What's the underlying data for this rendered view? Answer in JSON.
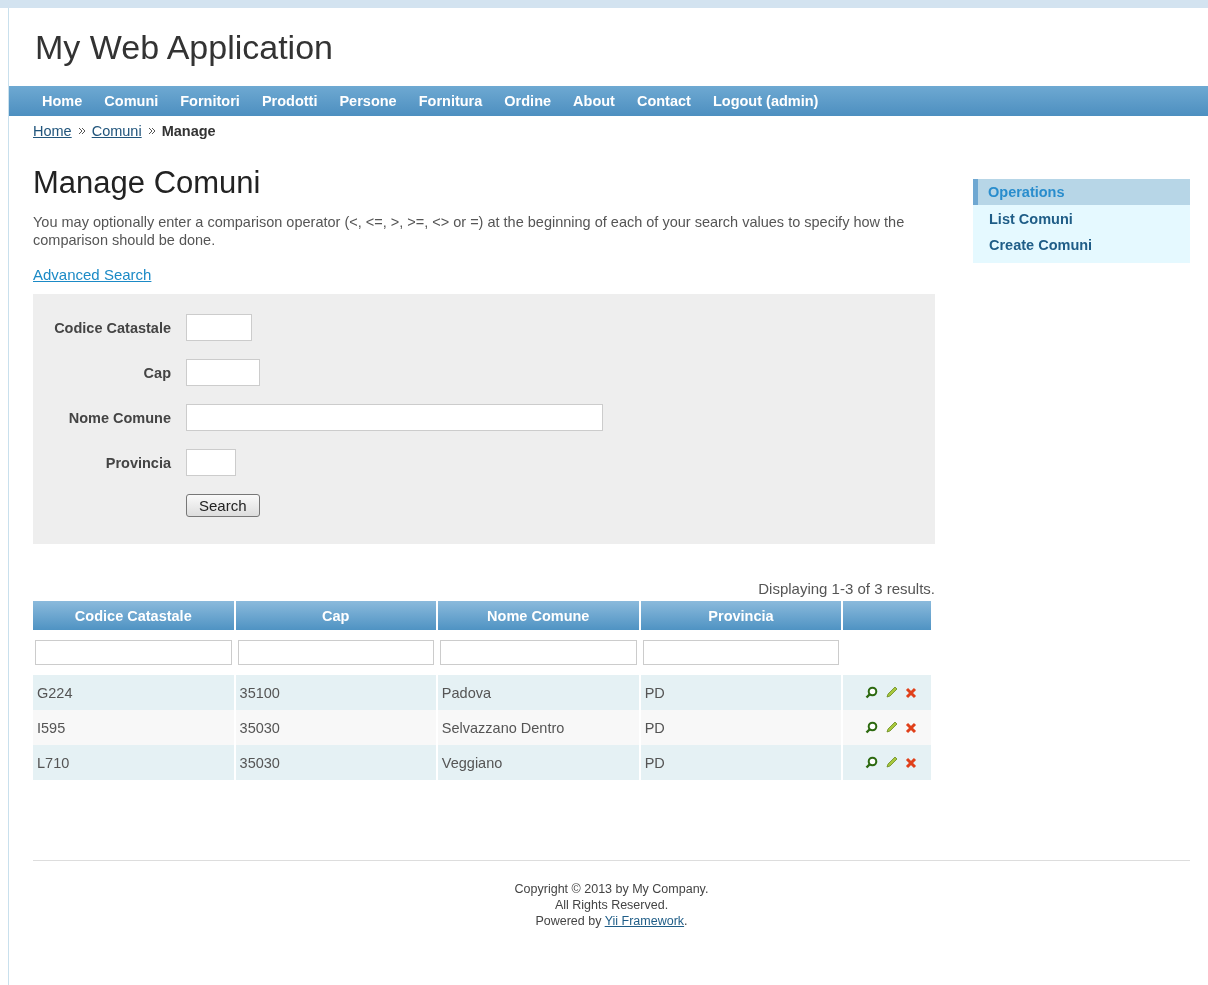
{
  "header": {
    "title": "My Web Application"
  },
  "nav": [
    {
      "label": "Home"
    },
    {
      "label": "Comuni"
    },
    {
      "label": "Fornitori"
    },
    {
      "label": "Prodotti"
    },
    {
      "label": "Persone"
    },
    {
      "label": "Fornitura"
    },
    {
      "label": "Ordine"
    },
    {
      "label": "About"
    },
    {
      "label": "Contact"
    },
    {
      "label": "Logout (admin)"
    }
  ],
  "breadcrumbs": [
    {
      "label": "Home",
      "kind": "link"
    },
    {
      "label": "Comuni",
      "kind": "link"
    },
    {
      "label": "Manage",
      "kind": "current"
    }
  ],
  "page": {
    "title": "Manage Comuni",
    "intro": "You may optionally enter a comparison operator (<, <=, >, >=, <> or =) at the beginning of each of your search values to specify how the comparison should be done.",
    "advanced_link": "Advanced Search"
  },
  "search_form": {
    "fields": [
      {
        "label": "Codice Catastale"
      },
      {
        "label": "Cap"
      },
      {
        "label": "Nome Comune"
      },
      {
        "label": "Provincia"
      }
    ],
    "button": "Search"
  },
  "grid": {
    "summary": "Displaying 1-3 of 3 results.",
    "columns": [
      "Codice Catastale",
      "Cap",
      "Nome Comune",
      "Provincia"
    ],
    "rows": [
      [
        "G224",
        "35100",
        "Padova",
        "PD"
      ],
      [
        "I595",
        "35030",
        "Selvazzano Dentro",
        "PD"
      ],
      [
        "L710",
        "35030",
        "Veggiano",
        "PD"
      ]
    ]
  },
  "sidebar": {
    "title": "Operations",
    "items": [
      "List Comuni",
      "Create Comuni"
    ]
  },
  "footer": {
    "line_1": "Copyright © 2013 by My Company.",
    "line_2": "All Rights Reserved.",
    "line_3_before": "Powered by ",
    "line_3_link": "Yii Framework",
    "line_3_after": "."
  }
}
